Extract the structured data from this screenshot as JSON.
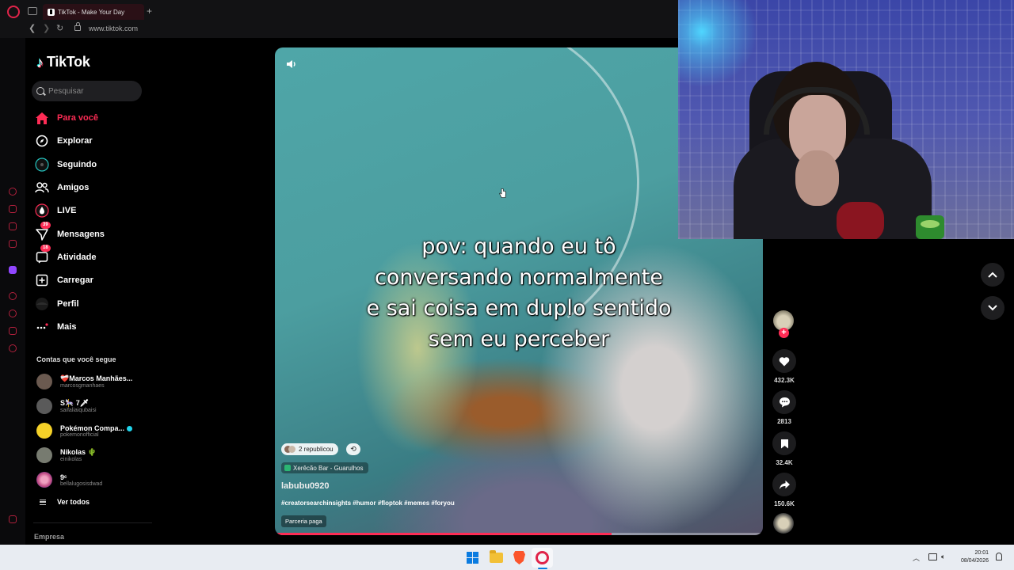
{
  "browser": {
    "tab_title": "TikTok - Make Your Day",
    "new_tab_glyph": "+",
    "address": "www.tiktok.com",
    "accent_color": "#e0244a"
  },
  "tiktok": {
    "logo_text": "TikTok",
    "search": {
      "placeholder": "Pesquisar",
      "value": ""
    },
    "nav": {
      "for_you": "Para você",
      "explore": "Explorar",
      "following": "Seguindo",
      "friends": "Amigos",
      "live": "LIVE",
      "messages": "Mensagens",
      "messages_badge": "39",
      "activity": "Atividade",
      "activity_badge": "18",
      "upload": "Carregar",
      "profile": "Perfil",
      "more": "Mais"
    },
    "following_title": "Contas que você segue",
    "following_accounts": [
      {
        "name": "❤️‍🩹Marcos Manhães...",
        "handle": "marcosgmanhaes",
        "avatar_color": "#6b5a50"
      },
      {
        "name": "S🎠 7🗡",
        "handle": "saifaliaiqubaisi",
        "avatar_color": "#5a5a5a"
      },
      {
        "name": "Pokémon Compa...",
        "handle": "pokemonofficial",
        "avatar_color": "#f5d128",
        "verified": true
      },
      {
        "name": "Nikolas 🌵",
        "handle": "einikolas",
        "avatar_color": "#777b70"
      },
      {
        "name": "9ᶜ",
        "handle": "bellalugosisdwad",
        "avatar_color": "#c04a82"
      }
    ],
    "see_all": "Ver todos",
    "footer_link": "Empresa",
    "brand_color": "#fe2c55"
  },
  "video": {
    "caption": "pov: quando eu tô\nconversando normalmente\ne sai coisa em duplo sentido\nsem eu perceber",
    "repost_text": "2 republicou",
    "location": "Xerêcão Bar - Guarulhos",
    "author": "labubu0920",
    "hashtags": "#creatorsearchinsights #humor #floptok #memes #foryou",
    "paid_label": "Parceria paga",
    "progress": 0.69
  },
  "actions": {
    "likes": "432.3K",
    "comments": "2813",
    "bookmarks": "32.4K",
    "shares": "150.6K"
  },
  "taskbar": {
    "time": "20:01",
    "date": "08/04/2026"
  }
}
